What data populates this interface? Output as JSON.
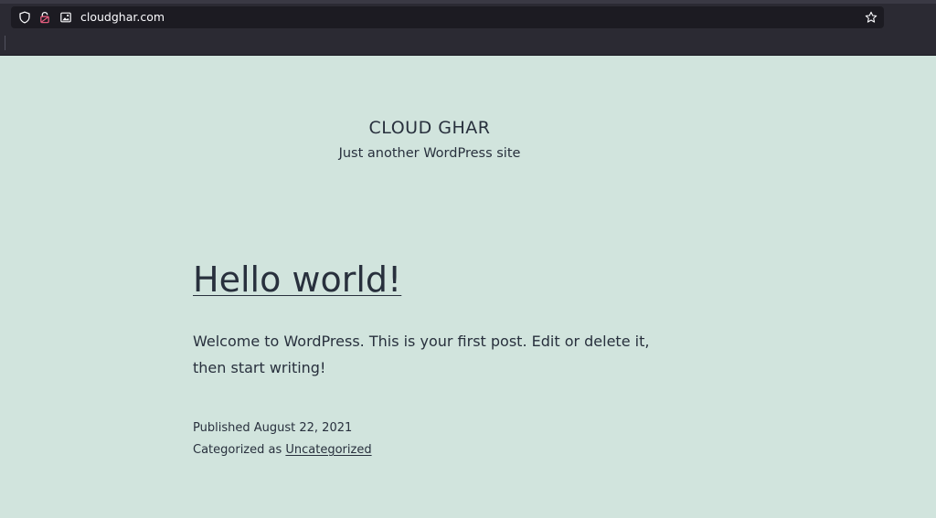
{
  "browser": {
    "url": "cloudghar.com",
    "icons": [
      "shield-icon",
      "lock-icon",
      "image-icon",
      "bookmark-star-icon"
    ]
  },
  "site": {
    "title": "CLOUD GHAR",
    "description": "Just another WordPress site"
  },
  "post": {
    "title": "Hello world!",
    "body": "Welcome to WordPress. This is your first post. Edit or delete it, then start writing!",
    "published_prefix": "Published",
    "published_date": "August 22, 2021",
    "category_prefix": "Categorized as",
    "category": "Uncategorized"
  },
  "colors": {
    "page_background": "#d1e4dd",
    "text": "#28303d",
    "chrome_background": "#2b2a33",
    "urlbar_background": "#1c1b22",
    "lock_icon": "#e25d7d"
  }
}
